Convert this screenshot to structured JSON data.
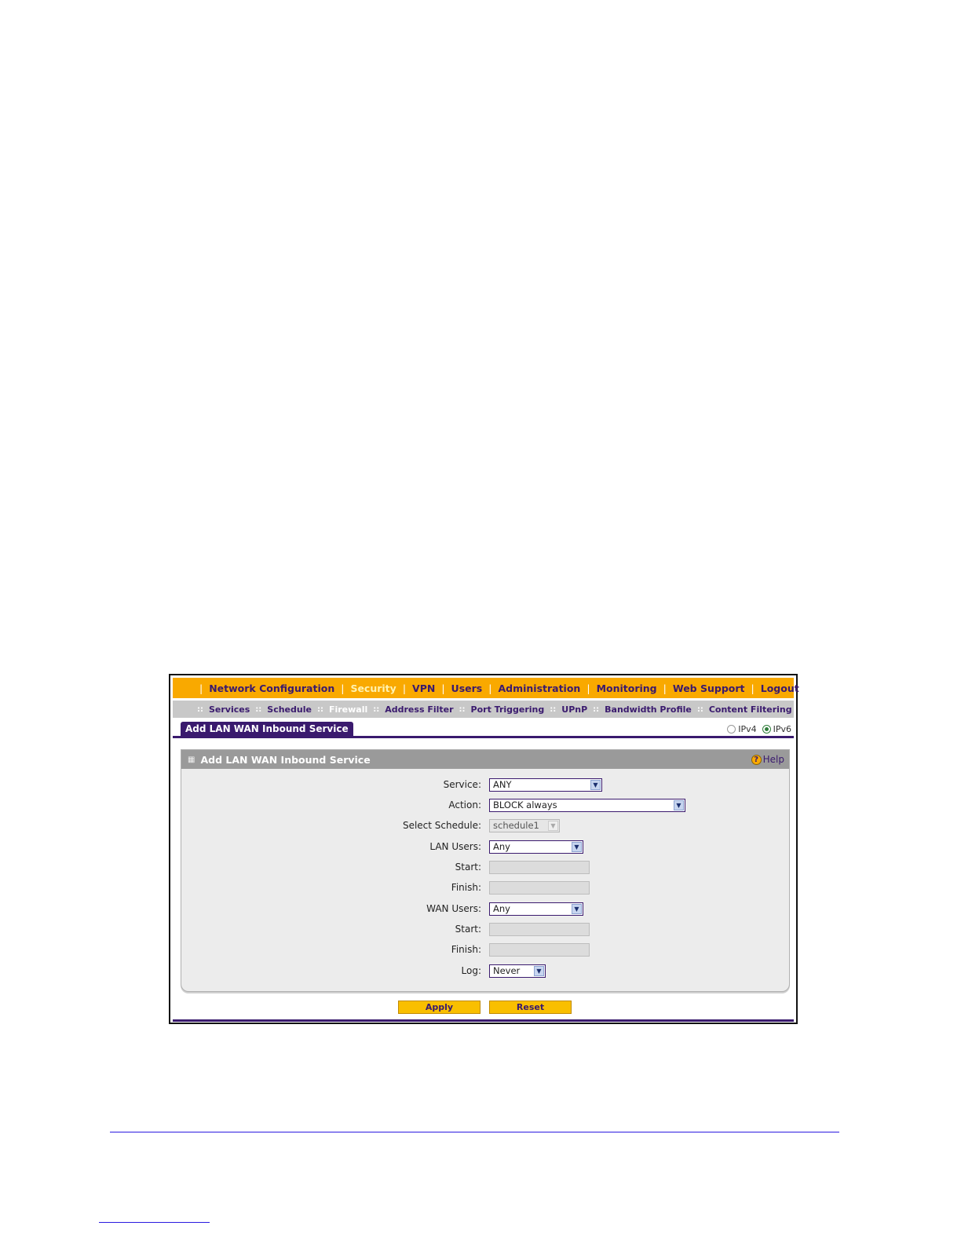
{
  "top_nav": {
    "items": [
      {
        "label": "Network Configuration"
      },
      {
        "label": "Security"
      },
      {
        "label": "VPN"
      },
      {
        "label": "Users"
      },
      {
        "label": "Administration"
      },
      {
        "label": "Monitoring"
      },
      {
        "label": "Web Support"
      },
      {
        "label": "Logout"
      }
    ],
    "active": "Security"
  },
  "sub_nav": {
    "items": [
      {
        "label": "Services"
      },
      {
        "label": "Schedule"
      },
      {
        "label": "Firewall"
      },
      {
        "label": "Address Filter"
      },
      {
        "label": "Port Triggering"
      },
      {
        "label": "UPnP"
      },
      {
        "label": "Bandwidth Profile"
      },
      {
        "label": "Content Filtering"
      }
    ],
    "active": "Firewall"
  },
  "tab": {
    "label": "Add LAN WAN Inbound Service"
  },
  "ip_mode": {
    "ipv4_label": "IPv4",
    "ipv6_label": "IPv6",
    "selected": "IPv6"
  },
  "panel": {
    "title": "Add LAN WAN Inbound Service",
    "help_label": "Help",
    "help_icon": "?"
  },
  "form": {
    "service": {
      "label": "Service:",
      "value": "ANY"
    },
    "action": {
      "label": "Action:",
      "value": "BLOCK always"
    },
    "schedule": {
      "label": "Select Schedule:",
      "value": "schedule1"
    },
    "lan_users": {
      "label": "LAN Users:",
      "value": "Any"
    },
    "lan_start": {
      "label": "Start:",
      "value": ""
    },
    "lan_finish": {
      "label": "Finish:",
      "value": ""
    },
    "wan_users": {
      "label": "WAN Users:",
      "value": "Any"
    },
    "wan_start": {
      "label": "Start:",
      "value": ""
    },
    "wan_finish": {
      "label": "Finish:",
      "value": ""
    },
    "log": {
      "label": "Log:",
      "value": "Never"
    }
  },
  "buttons": {
    "apply": "Apply",
    "reset": "Reset"
  },
  "colors": {
    "brand_orange": "#f9a900",
    "brand_purple": "#3a1a6e",
    "subnav_gray": "#c8c8c8",
    "button_yellow": "#f9bf00"
  }
}
